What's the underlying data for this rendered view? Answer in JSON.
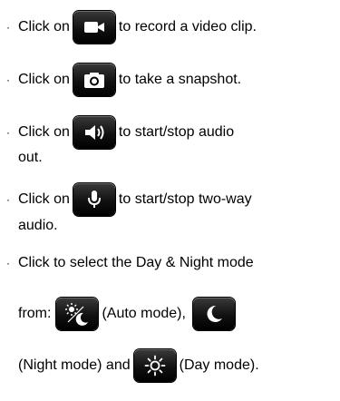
{
  "bullet": "·",
  "items": [
    {
      "before": "Click on",
      "icon": "video-camera-icon",
      "after": "to record a video clip."
    },
    {
      "before": "Click on",
      "icon": "camera-snapshot-icon",
      "after": "to take a snapshot."
    },
    {
      "before": "Click on",
      "icon": "speaker-audio-icon",
      "after": "to start/stop audio",
      "cont": "out."
    },
    {
      "before": "Click on",
      "icon": "microphone-icon",
      "after": "to start/stop two-way",
      "cont": "audio."
    },
    {
      "line1": "Click to select the Day & Night mode",
      "from": "from:",
      "auto_icon": "sun-moon-auto-icon",
      "auto_label": "(Auto mode),",
      "night_icon": "moon-icon",
      "night_label": "(Night mode) and",
      "day_icon": "sun-icon",
      "day_label": "(Day mode)."
    }
  ]
}
